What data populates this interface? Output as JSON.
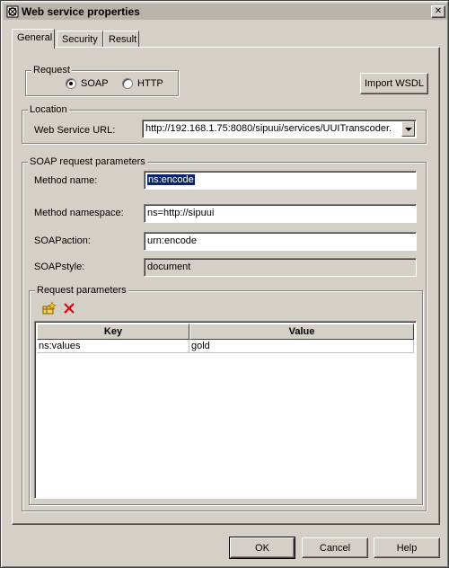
{
  "window": {
    "title": "Web service properties",
    "close_glyph": "✕"
  },
  "tabs": [
    {
      "label": "General",
      "active": true
    },
    {
      "label": "Security",
      "active": false
    },
    {
      "label": "Result",
      "active": false
    }
  ],
  "request": {
    "group_label": "Request",
    "options": [
      {
        "label": "SOAP",
        "checked": true
      },
      {
        "label": "HTTP",
        "checked": false
      }
    ],
    "import_button": "Import WSDL"
  },
  "location": {
    "group_label": "Location",
    "url_label": "Web Service URL:",
    "url_value": "http://192.168.1.75:8080/sipuui/services/UUITranscoder."
  },
  "soap": {
    "group_label": "SOAP request parameters",
    "method_name_label": "Method name:",
    "method_name_value": "ns:encode",
    "method_namespace_label": "Method namespace:",
    "method_namespace_value": "ns=http://sipuui",
    "soapaction_label": "SOAPaction:",
    "soapaction_value": "urn:encode",
    "soapstyle_label": "SOAPstyle:",
    "soapstyle_value": "document"
  },
  "request_parameters": {
    "group_label": "Request parameters",
    "add_icon": "add-row-icon",
    "delete_icon": "delete-row-icon",
    "columns": [
      "Key",
      "Value"
    ],
    "rows": [
      {
        "key": "ns:values",
        "value": "gold"
      }
    ]
  },
  "footer": {
    "ok_label": "OK",
    "cancel_label": "Cancel",
    "help_label": "Help"
  },
  "colors": {
    "face": "#d4d0c8",
    "selection": "#0a246a",
    "delete_red": "#e00000"
  }
}
